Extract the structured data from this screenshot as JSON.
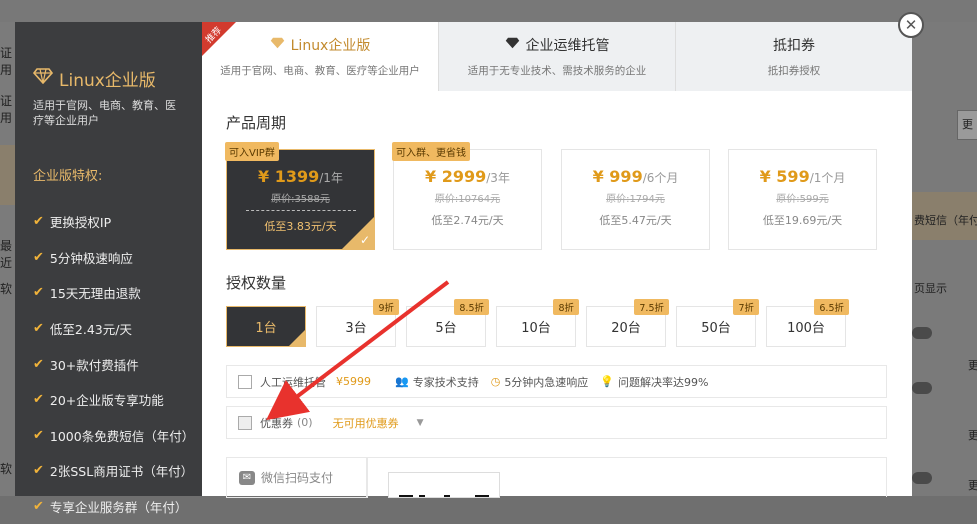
{
  "background": {
    "left_fragments": [
      "证用",
      "证用",
      "最近",
      "软",
      "软"
    ],
    "right_fragments": [
      "费短信（年付",
      "页显示"
    ],
    "right_button": "更",
    "right_links": [
      "更",
      "更",
      "更"
    ]
  },
  "sidebar": {
    "title": "Linux企业版",
    "subtitle": "适用于官网、电商、教育、医疗等企业用户",
    "features_title": "企业版特权:",
    "features": [
      "更换授权IP",
      "5分钟极速响应",
      "15天无理由退款",
      "低至2.43元/天",
      "30+款付费插件",
      "20+企业版专享功能",
      "1000条免费短信（年付）",
      "2张SSL商用证书（年付）",
      "专享企业服务群（年付）"
    ]
  },
  "tabs": [
    {
      "title": "Linux企业版",
      "subtitle": "适用于官网、电商、教育、医疗等企业用户",
      "icon": "diamond-icon",
      "active": true,
      "badge": "推荐"
    },
    {
      "title": "企业运维托管",
      "subtitle": "适用于无专业技术、需技术服务的企业",
      "icon": "diamond-icon",
      "active": false
    },
    {
      "title": "抵扣券",
      "subtitle": "抵扣券授权",
      "active": false
    }
  ],
  "cycle": {
    "label": "产品周期",
    "plans": [
      {
        "tag": "可入VIP群",
        "price": "¥ 1399",
        "unit": "/1年",
        "original": "原价:3588元",
        "daily": "低至3.83元/天",
        "selected": true
      },
      {
        "tag": "可入群、更省钱",
        "price": "¥ 2999",
        "unit": "/3年",
        "original": "原价:10764元",
        "daily": "低至2.74元/天",
        "selected": false
      },
      {
        "tag": "",
        "price": "¥ 999",
        "unit": "/6个月",
        "original": "原价:1794元",
        "daily": "低至5.47元/天",
        "selected": false
      },
      {
        "tag": "",
        "price": "¥ 599",
        "unit": "/1个月",
        "original": "原价:599元",
        "daily": "低至19.69元/天",
        "selected": false
      }
    ]
  },
  "quantity": {
    "label": "授权数量",
    "options": [
      {
        "label": "1台",
        "discount": "",
        "selected": true
      },
      {
        "label": "3台",
        "discount": "9折",
        "selected": false
      },
      {
        "label": "5台",
        "discount": "8.5折",
        "selected": false
      },
      {
        "label": "10台",
        "discount": "8折",
        "selected": false
      },
      {
        "label": "20台",
        "discount": "7.5折",
        "selected": false
      },
      {
        "label": "50台",
        "discount": "7折",
        "selected": false
      },
      {
        "label": "100台",
        "discount": "6.5折",
        "selected": false
      }
    ]
  },
  "ops": {
    "label": "人工运维托管",
    "price": "¥5999",
    "features": [
      "专家技术支持",
      "5分钟内急速响应",
      "问题解决率达99%"
    ]
  },
  "coupon": {
    "label": "优惠券",
    "count": "(0)",
    "select_value": "无可用优惠券"
  },
  "payment": {
    "method": "微信扫码支付"
  },
  "colors": {
    "gold": "#e09a1a",
    "sidebar_bg": "#3c3d3f",
    "selected_bg": "#333437",
    "annotation_arrow": "#e8322d"
  }
}
